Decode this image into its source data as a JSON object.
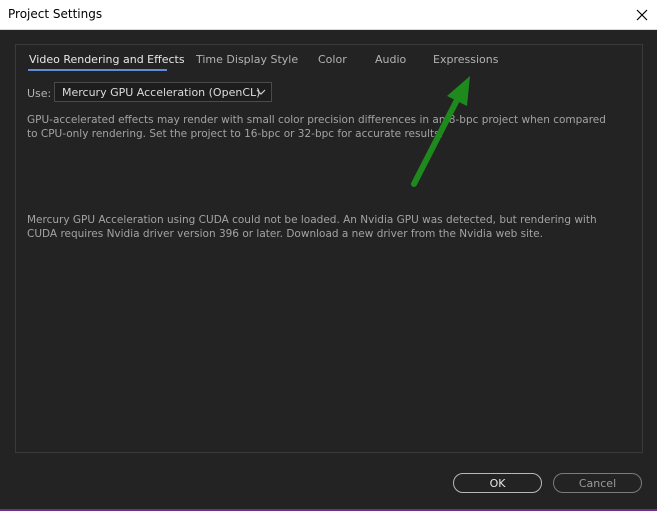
{
  "window": {
    "title": "Project Settings"
  },
  "tabs": [
    {
      "label": "Video Rendering and Effects",
      "active": true
    },
    {
      "label": "Time Display Style",
      "active": false
    },
    {
      "label": "Color",
      "active": false
    },
    {
      "label": "Audio",
      "active": false
    },
    {
      "label": "Expressions",
      "active": false
    }
  ],
  "renderer": {
    "use_label": "Use:",
    "selected": "Mercury GPU Acceleration (OpenCL)"
  },
  "messages": {
    "precision_note": "GPU-accelerated effects may render with small color precision differences in an 8-bpc project when compared to CPU-only rendering. Set the project to 16-bpc or 32-bpc for accurate results.",
    "cuda_warning": "Mercury GPU Acceleration using CUDA could not be loaded. An Nvidia GPU was detected, but rendering with CUDA requires Nvidia driver version 396 or later. Download a new driver from the Nvidia web site."
  },
  "buttons": {
    "ok": "OK",
    "cancel": "Cancel"
  },
  "colors": {
    "annotation_arrow": "#1e8a1e",
    "active_tab_underline": "#5f8ed4",
    "background": "#232323"
  },
  "icons": {
    "close": "close-icon",
    "dropdown": "chevron-down-icon"
  }
}
